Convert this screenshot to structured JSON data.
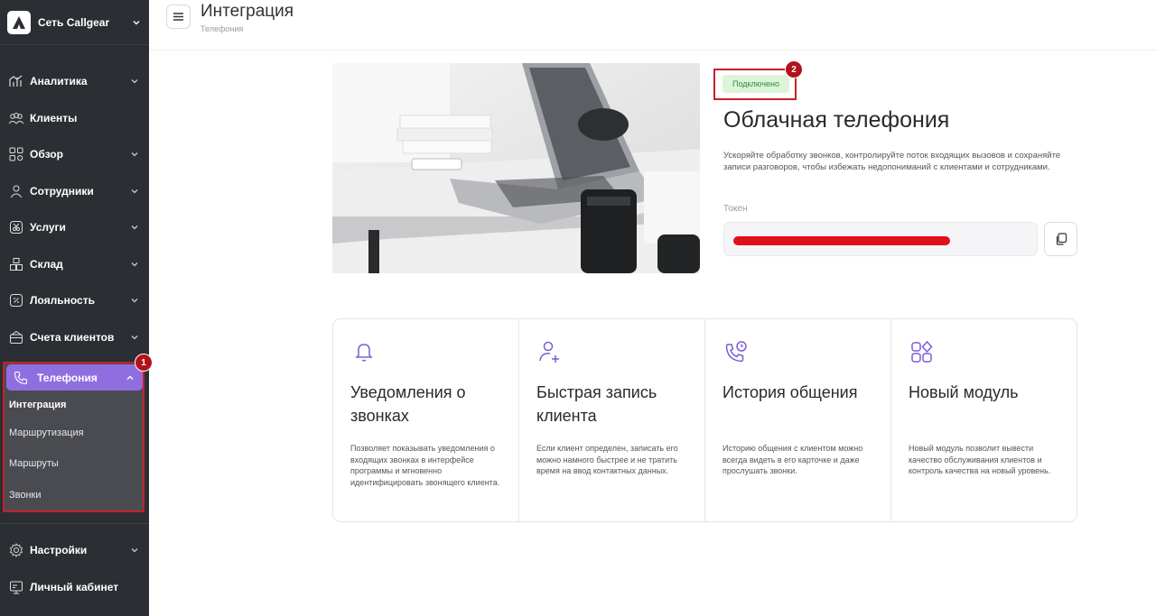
{
  "sidebar": {
    "brand": "Сеть Callgear",
    "items": [
      {
        "label": "Аналитика",
        "icon": "analytics-icon",
        "chevron": true
      },
      {
        "label": "Клиенты",
        "icon": "clients-icon",
        "chevron": false
      },
      {
        "label": "Обзор",
        "icon": "overview-icon",
        "chevron": true
      },
      {
        "label": "Сотрудники",
        "icon": "employees-icon",
        "chevron": true
      },
      {
        "label": "Услуги",
        "icon": "services-icon",
        "chevron": true
      },
      {
        "label": "Склад",
        "icon": "warehouse-icon",
        "chevron": true
      },
      {
        "label": "Лояльность",
        "icon": "loyalty-icon",
        "chevron": true
      },
      {
        "label": "Счета клиентов",
        "icon": "client-accounts-icon",
        "chevron": true
      }
    ],
    "telephony": {
      "label": "Телефония",
      "badge": "1",
      "subitems": [
        "Интеграция",
        "Маршрутизация",
        "Маршруты",
        "Звонки"
      ],
      "active": "Интеграция"
    },
    "bottom": [
      {
        "label": "Настройки",
        "icon": "settings-icon",
        "chevron": true
      },
      {
        "label": "Личный кабинет",
        "icon": "account-icon",
        "chevron": false
      }
    ]
  },
  "header": {
    "title": "Интеграция",
    "breadcrumb": "Телефония"
  },
  "integration": {
    "status": "Подключено",
    "status_badge": "2",
    "title": "Облачная телефония",
    "description": "Ускоряйте обработку звонков, контролируйте поток входящих вызовов и сохраняйте записи разговоров, чтобы избежать недопониманий с клиентами и сотрудниками.",
    "token_label": "Токен"
  },
  "features": [
    {
      "icon": "bell-icon",
      "title": "Уведомления о звонках",
      "description": "Позволяет показывать уведомления о входящих звонках в интерфейсе программы и мгновенно идентифицировать звонящего клиента."
    },
    {
      "icon": "add-user-icon",
      "title": "Быстрая запись клиента",
      "description": "Если клиент определен, записать его можно намного быстрее и не тратить время на ввод контактных данных."
    },
    {
      "icon": "call-history-icon",
      "title": "История общения",
      "description": "Историю общения с клиентом можно всегда видеть в его карточке и даже прослушать звонки."
    },
    {
      "icon": "modules-icon",
      "title": "Новый модуль",
      "description": "Новый модуль позволит вывести качество обслуживания клиентов и контроль качества на новый уровень."
    }
  ],
  "colors": {
    "sidebar_bg": "#2b2e33",
    "accent": "#8f6fe0",
    "highlight_red": "#c8202a",
    "status_bg": "#dcf5d8",
    "status_text": "#2e8c3a"
  }
}
